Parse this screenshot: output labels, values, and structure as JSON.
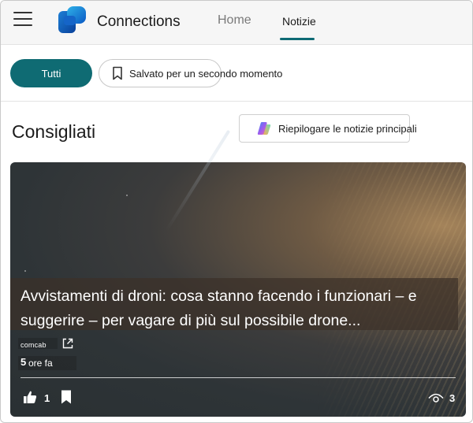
{
  "app": {
    "title": "Connections"
  },
  "nav": {
    "tabs": [
      {
        "label": "Home",
        "selected": false
      },
      {
        "label": "Notizie",
        "selected": true
      }
    ]
  },
  "filters": {
    "all_label": "Tutti",
    "saved_label": "Salvato per un secondo momento"
  },
  "section": {
    "title": "Consigliati",
    "summarize_label": "Riepilogare le notizie principali"
  },
  "article": {
    "headline": "Avvistamenti di droni: cosa stanno facendo i funzionari – e suggerire – per vagare di più sul possibile drone...",
    "source": "comcab",
    "time_number": "5",
    "time_unit": "ore fa",
    "likes": "1",
    "views": "3"
  },
  "colors": {
    "accent": "#0f6b73",
    "header_bg": "#f6f6f6"
  },
  "icons": [
    "hamburger-icon",
    "app-logo-icon",
    "bookmark-icon",
    "copilot-icon",
    "open-external-icon",
    "thumbs-up-icon",
    "bookmark-filled-icon",
    "eye-icon"
  ]
}
